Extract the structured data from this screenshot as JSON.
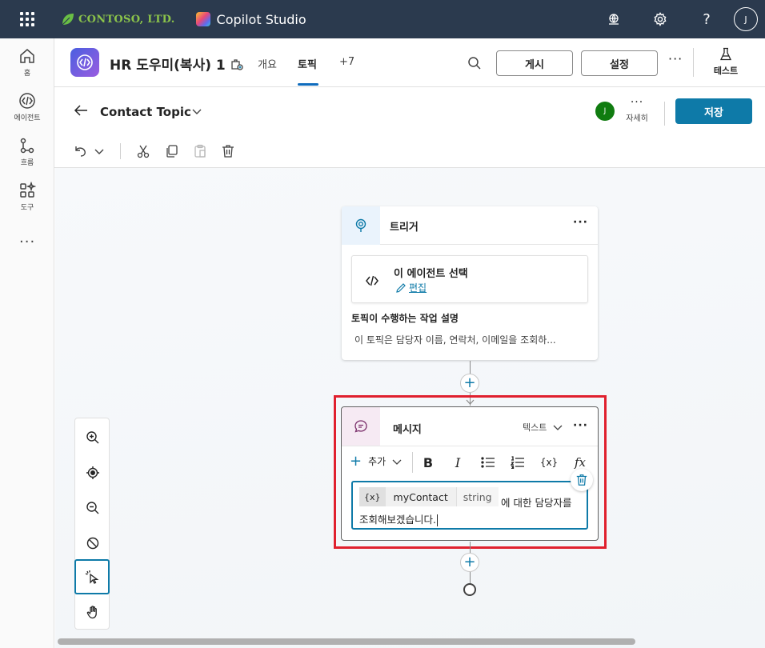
{
  "topbar": {
    "brand_name": "CONTOSO, LTD.",
    "product_name": "Copilot Studio",
    "avatar_initial": "J"
  },
  "rail": {
    "items": [
      {
        "label": "홈",
        "icon": "home-icon"
      },
      {
        "label": "에이전트",
        "icon": "agent-icon"
      },
      {
        "label": "흐름",
        "icon": "flow-icon"
      },
      {
        "label": "도구",
        "icon": "tools-icon"
      }
    ],
    "more": "···"
  },
  "header": {
    "agent_title": "HR 도우미(복사) 1",
    "tabs": [
      {
        "label": "개요",
        "active": false
      },
      {
        "label": "토픽",
        "active": true
      },
      {
        "label": "+7",
        "active": false
      }
    ],
    "publish_label": "게시",
    "settings_label": "설정",
    "more": "···",
    "test_label": "테스트"
  },
  "topic": {
    "name": "Contact Topic",
    "user_initial": "J",
    "details_label": "자세히",
    "save_label": "저장"
  },
  "trigger": {
    "title": "트리거",
    "more": "···",
    "agent_select_title": "이 에이전트 선택",
    "edit_label": "편집",
    "description_label": "토픽이 수행하는 작업 설명",
    "description_text": "이 토픽은 담당자 이름, 연락처, 이메일을 조회하..."
  },
  "message": {
    "title": "메시지",
    "type_label": "텍스트",
    "more": "···",
    "add_label": "추가",
    "tools": {
      "bold": "B",
      "italic": "I",
      "variable": "{x}",
      "formula": "fx"
    },
    "variable_icon": "{x}",
    "variable_name": "myContact",
    "variable_type": "string",
    "text_line1": "에 대한 담당자를",
    "text_line2": "조회해보겠습니다."
  },
  "colors": {
    "topbar": "#2b3a4e",
    "accent": "#0e7aa8",
    "highlight": "#e0202e"
  }
}
